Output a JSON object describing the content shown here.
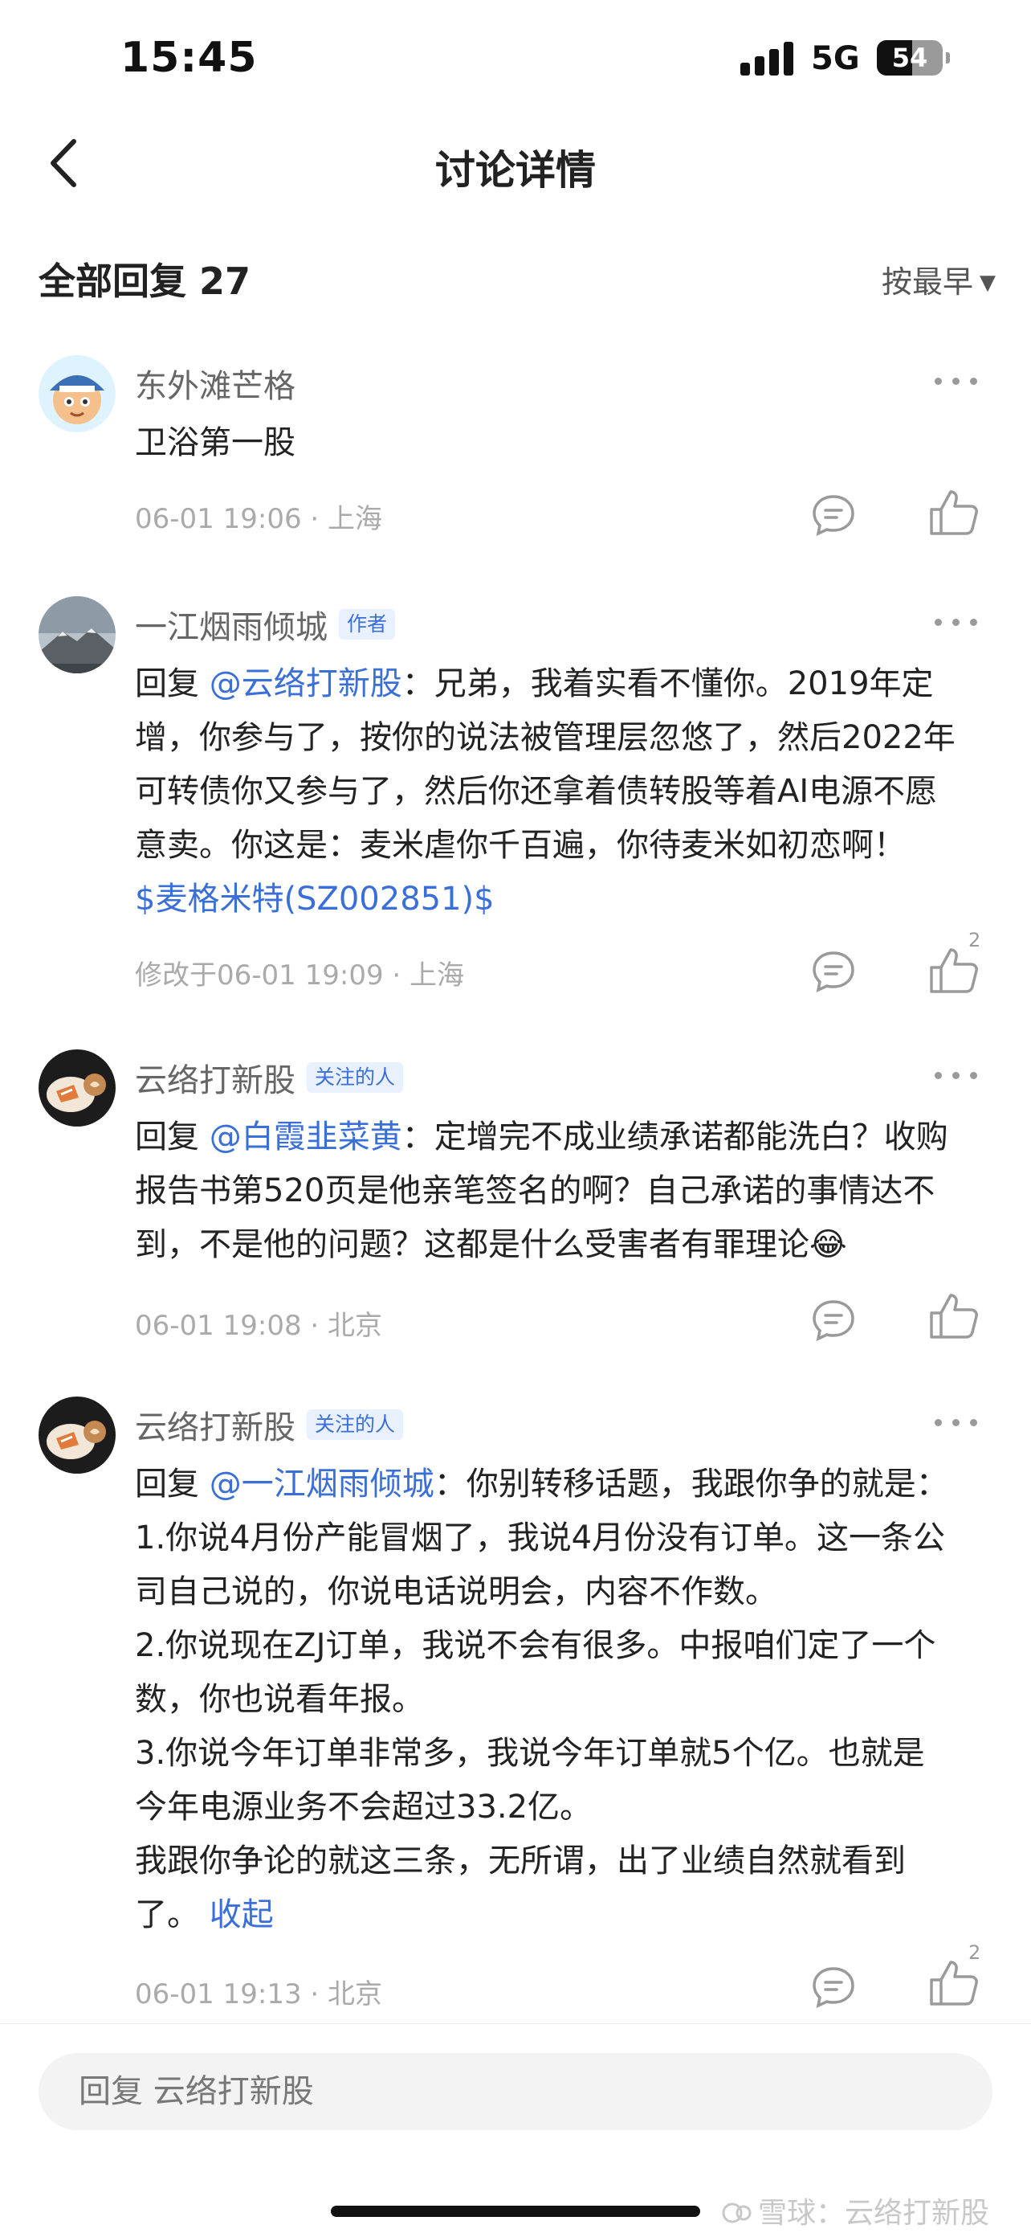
{
  "status_bar": {
    "time": "15:45",
    "network": "5G",
    "battery": "54",
    "battery_level": 0.54
  },
  "nav": {
    "title": "讨论详情"
  },
  "replies_header": {
    "title": "全部回复 27",
    "sort_label": "按最早"
  },
  "comments": [
    {
      "author": "东外滩芒格",
      "tag": "",
      "text": "卫浴第一股",
      "meta": "06-01 19:06 · 上海",
      "likes": ""
    },
    {
      "author": "一江烟雨倾城",
      "tag": "作者",
      "reply_prefix": "回复 ",
      "mention": "@云络打新股",
      "lines": [
        "：兄弟，我着实看不懂你。2019年定",
        "增，你参与了，按你的说法被管理层忽悠了，然后2022年",
        "可转债你又参与了，然后你还拿着债转股等着AI电源不愿",
        "意卖。你这是：麦米虐你千百遍，你待麦米如初恋啊！"
      ],
      "stock": "$麦格米特(SZ002851)$",
      "meta": "修改于06-01 19:09 · 上海",
      "likes": "2"
    },
    {
      "author": "云络打新股",
      "tag": "关注的人",
      "reply_prefix": "回复 ",
      "mention": "@白霞韭菜黄",
      "lines": [
        "：定增完不成业绩承诺都能洗白？收购",
        "报告书第520页是他亲笔签名的啊？自己承诺的事情达不",
        "到，不是他的问题？这都是什么受害者有罪理论😂"
      ],
      "meta": "06-01 19:08 · 北京",
      "likes": ""
    },
    {
      "author": "云络打新股",
      "tag": "关注的人",
      "reply_prefix": "回复 ",
      "mention": "@一江烟雨倾城",
      "lines": [
        "：你别转移话题，我跟你争的就是：",
        "1.你说4月份产能冒烟了，我说4月份没有订单。这一条公",
        "司自己说的，你说电话说明会，内容不作数。",
        "2.你说现在ZJ订单，我说不会有很多。中报咱们定了一个",
        "数，你也说看年报。",
        "3.你说今年订单非常多，我说今年订单就5个亿。也就是",
        "今年电源业务不会超过33.2亿。",
        "我跟你争论的就这三条，无所谓，出了业绩自然就看到",
        "了。 "
      ],
      "collapse_label": "收起",
      "meta": "06-01 19:13 · 北京",
      "likes": "2"
    }
  ],
  "bottom": {
    "reply_placeholder": "回复 云络打新股",
    "watermark": "雪球：云络打新股"
  },
  "colors": {
    "link": "#3a6fd8",
    "meta": "#aaaaaa",
    "tag_bg": "#e9f0ff"
  },
  "icons": [
    "back-chevron-icon",
    "more-dots-icon",
    "reply-bubble-icon",
    "thumbs-up-icon",
    "dropdown-caret-icon",
    "signal-bars-icon",
    "battery-icon",
    "snowball-logo-icon"
  ]
}
